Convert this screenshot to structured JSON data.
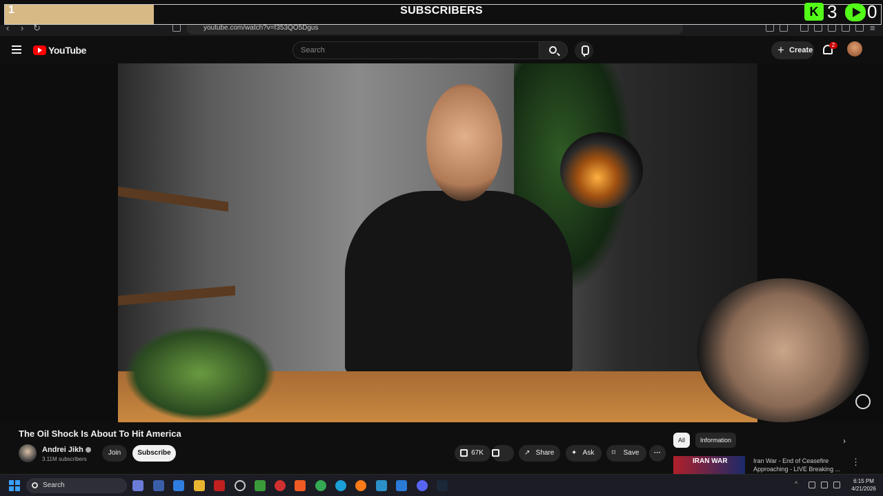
{
  "overlay": {
    "progress_count": "1",
    "progress_fraction": 0.17,
    "title": "SUBSCRIBERS",
    "kick_count": "3",
    "rumble_count": "0"
  },
  "browser": {
    "url": "youtube.com/watch?v=f353QO5Dgus"
  },
  "header": {
    "logo_text": "YouTube",
    "search_placeholder": "Search",
    "create_label": "Create",
    "notification_count": "2"
  },
  "video": {
    "title": "The Oil Shock Is About To Hit America",
    "channel_name": "Andrei Jikh",
    "subscribers": "3.11M subscribers",
    "join_label": "Join",
    "subscribe_label": "Subscribe",
    "like_count": "67K",
    "share_label": "Share",
    "ask_label": "Ask",
    "save_label": "Save",
    "more_label": "···"
  },
  "sidebar": {
    "chips": [
      "All",
      "Information"
    ],
    "recommendation": {
      "thumb_tag": "IRAN WAR",
      "title": "Iran War - End of Ceasefire Approaching - LIVE Breaking ..."
    }
  },
  "taskbar": {
    "search_label": "Search",
    "time": "6:15 PM",
    "date": "4/21/2026"
  },
  "colors": {
    "youtube_red": "#ff0000",
    "background": "#0f0f0f",
    "overlay_fill": "#d6b985",
    "kick_green": "#53fc18"
  }
}
